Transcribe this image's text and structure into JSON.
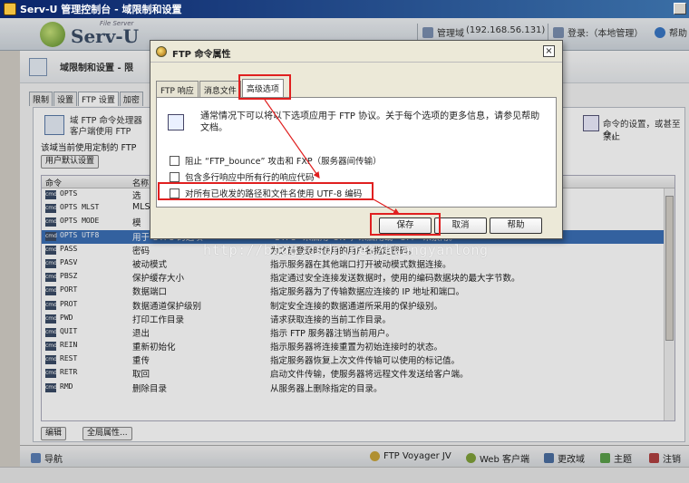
{
  "window": {
    "title": "Serv-U 管理控制台 - 域限制和设置"
  },
  "header": {
    "logo_sub": "File Server",
    "logo_name": "Serv-U",
    "admin_domain": "管理域",
    "ip": "(192.168.56.131)",
    "login": "登录:（本地管理）",
    "help": "帮助"
  },
  "page": {
    "title": "域限制和设置 - 限",
    "tabs": [
      "限制",
      "设置",
      "FTP 设置",
      "加密"
    ],
    "desc_line1": "域 FTP 命令处理器",
    "desc_line2": "客户端使用 FTP",
    "desc_right1": "命令的设置，或甚至禁止",
    "desc_right2": "令。",
    "line3": "该域当前使用定制的 FTP",
    "user_default_btn": "用户默认设置",
    "columns": [
      "命令",
      "名称"
    ],
    "rows": [
      {
        "cmd": "OPTS",
        "name": "选",
        "desc": ""
      },
      {
        "cmd": "OPTS MLST",
        "name": "MLS",
        "desc": ""
      },
      {
        "cmd": "OPTS MODE",
        "name": "模",
        "desc": ""
      },
      {
        "cmd": "OPTS UTF8",
        "name": "用于 UTF8 的选项",
        "desc": "\"UTF8\" 来启用\"ON\"，来启用或 \"OFF\" 来禁用。"
      },
      {
        "cmd": "PASS",
        "name": "密码",
        "desc": "为之前登录时使用的用户名指定密码。"
      },
      {
        "cmd": "PASV",
        "name": "被动模式",
        "desc": "指示服务器在其他端口打开被动模式数据连接。"
      },
      {
        "cmd": "PBSZ",
        "name": "保护缓存大小",
        "desc": "指定通过安全连接发送数据时，使用的编码数据块的最大字节数。"
      },
      {
        "cmd": "PORT",
        "name": "数据端口",
        "desc": "指定服务器为了传输数据应连接的 IP 地址和端口。"
      },
      {
        "cmd": "PROT",
        "name": "数据通道保护级别",
        "desc": "制定安全连接的数据通道所采用的保护级别。"
      },
      {
        "cmd": "PWD",
        "name": "打印工作目录",
        "desc": "请求获取连接的当前工作目录。"
      },
      {
        "cmd": "QUIT",
        "name": "退出",
        "desc": "指示 FTP 服务器注销当前用户。"
      },
      {
        "cmd": "REIN",
        "name": "重新初始化",
        "desc": "指示服务器将连接重置为初始连接时的状态。"
      },
      {
        "cmd": "REST",
        "name": "重传",
        "desc": "指定服务器恢复上次文件传输可以使用的标记值。"
      },
      {
        "cmd": "RETR",
        "name": "取回",
        "desc": "启动文件传输，使服务器将远程文件发送给客户端。"
      },
      {
        "cmd": "RMD",
        "name": "删除目录",
        "desc": "从服务器上删除指定的目录。"
      }
    ],
    "edit_btn": "编辑",
    "global_btn": "全局属性..."
  },
  "bottombar": {
    "nav": "导航",
    "ftp_voyager": "FTP Voyager JV",
    "web_client": "Web 客户端",
    "change_domain": "更改域",
    "home": "主题",
    "logout": "注销"
  },
  "dialog": {
    "title": "FTP 命令属性",
    "close": "☒",
    "tabs": [
      "FTP 响应",
      "消息文件",
      "高级选项"
    ],
    "info": "通常情况下可以将以下选项应用于 FTP 协议。关于每个选项的更多信息，请参见帮助文档。",
    "checkboxes": [
      "阻止 “FTP_bounce” 攻击和 FXP（服务器间传输）",
      "包含多行响应中所有行的响应代码",
      "对所有已收发的路径和文件名使用 UTF-8 编码"
    ],
    "buttons": {
      "save": "保存",
      "cancel": "取消",
      "help": "帮助"
    }
  },
  "watermark": "http://blog.csdn.net/huangyanlong"
}
